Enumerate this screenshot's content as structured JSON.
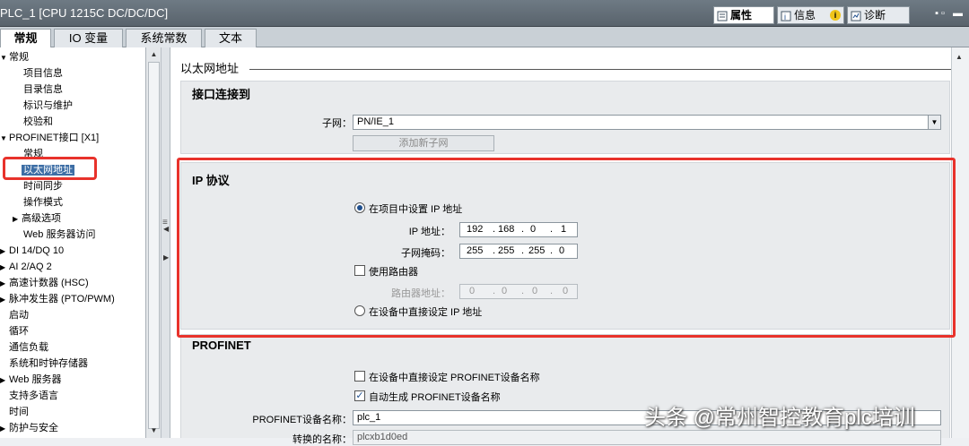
{
  "window": {
    "title": "PLC_1 [CPU 1215C DC/DC/DC]",
    "inspector_tabs": [
      "属性",
      "信息",
      "诊断"
    ],
    "info_badge": "i"
  },
  "tabs": [
    "常规",
    "IO 变量",
    "系统常数",
    "文本"
  ],
  "tree": {
    "items": [
      {
        "label": "常规",
        "arrow": "▼"
      },
      {
        "label": "项目信息",
        "arrow": ""
      },
      {
        "label": "目录信息",
        "arrow": ""
      },
      {
        "label": "标识与维护",
        "arrow": ""
      },
      {
        "label": "校验和",
        "arrow": ""
      },
      {
        "label": "PROFINET接口 [X1]",
        "arrow": "▼"
      },
      {
        "label": "常规",
        "arrow": ""
      },
      {
        "label": "以太网地址",
        "arrow": ""
      },
      {
        "label": "时间同步",
        "arrow": ""
      },
      {
        "label": "操作模式",
        "arrow": ""
      },
      {
        "label": "高级选项",
        "arrow": "▶"
      },
      {
        "label": "Web 服务器访问",
        "arrow": ""
      },
      {
        "label": "DI 14/DQ 10",
        "arrow": "▶"
      },
      {
        "label": "AI 2/AQ 2",
        "arrow": "▶"
      },
      {
        "label": "高速计数器 (HSC)",
        "arrow": "▶"
      },
      {
        "label": "脉冲发生器 (PTO/PWM)",
        "arrow": "▶"
      },
      {
        "label": "启动",
        "arrow": ""
      },
      {
        "label": "循环",
        "arrow": ""
      },
      {
        "label": "通信负载",
        "arrow": ""
      },
      {
        "label": "系统和时钟存储器",
        "arrow": ""
      },
      {
        "label": "Web 服务器",
        "arrow": "▶"
      },
      {
        "label": "支持多语言",
        "arrow": ""
      },
      {
        "label": "时间",
        "arrow": ""
      },
      {
        "label": "防护与安全",
        "arrow": "▶"
      }
    ]
  },
  "content": {
    "section_title": "以太网地址",
    "interface": {
      "title": "接口连接到",
      "subnet_label": "子网：",
      "subnet_value": "PN/IE_1",
      "add_subnet_button": "添加新子网"
    },
    "ip": {
      "title": "IP 协议",
      "option_set_in_project": "在项目中设置 IP 地址",
      "ip_label": "IP 地址：",
      "ip_octets": [
        "192",
        "168",
        "0",
        "1"
      ],
      "mask_label": "子网掩码：",
      "mask_octets": [
        "255",
        "255",
        "255",
        "0"
      ],
      "use_router": "使用路由器",
      "router_label": "路由器地址：",
      "router_octets": [
        "0",
        "0",
        "0",
        "0"
      ],
      "option_set_on_device": "在设备中直接设定 IP 地址",
      "selected_option": "在项目中设置 IP 地址"
    },
    "profinet": {
      "title": "PROFINET",
      "direct_name_on_device": "在设备中直接设定 PROFINET设备名称",
      "auto_generate_name": "自动生成 PROFINET设备名称",
      "device_name_label": "PROFINET设备名称：",
      "device_name_value": "plc_1",
      "converted_name_label": "转换的名称：",
      "converted_name_value": "plcxb1d0ed"
    }
  },
  "watermark": "头条 @常州智控教育plc培训",
  "colors": {
    "highlight_red": "#e8322b",
    "selection_blue": "#3d6ea5"
  }
}
